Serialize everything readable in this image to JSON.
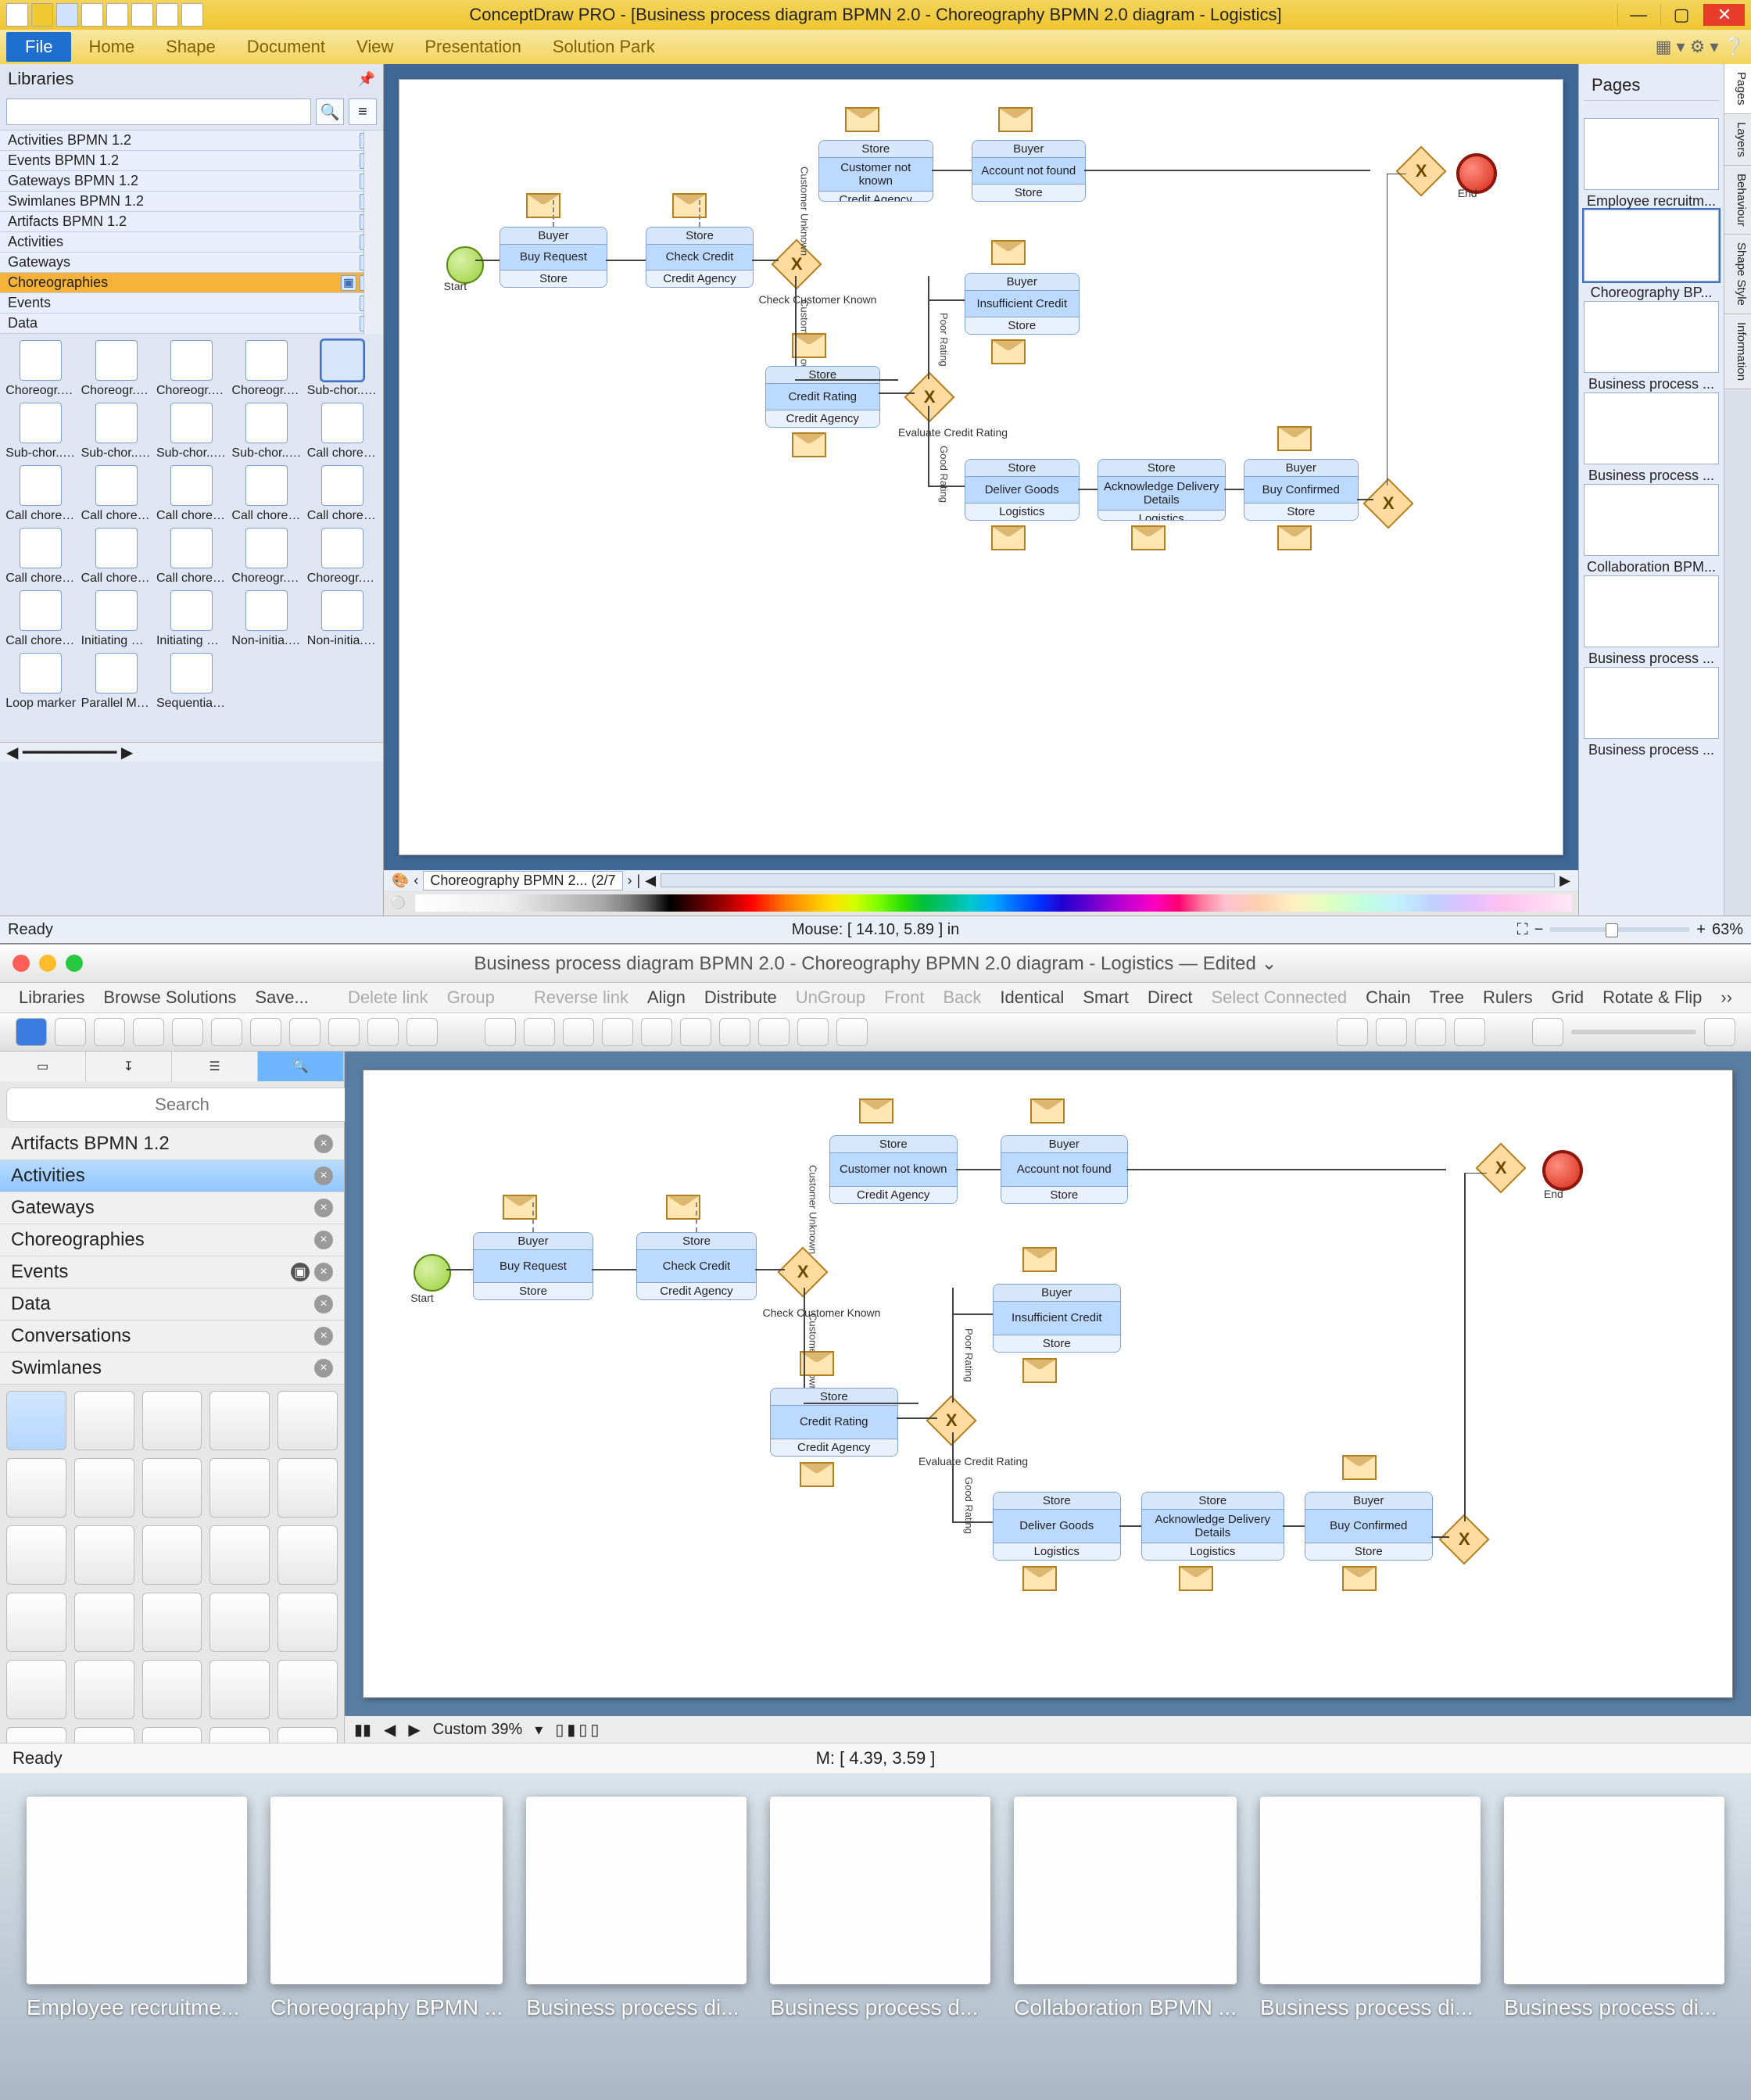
{
  "win": {
    "title": "ConceptDraw PRO - [Business process diagram BPMN 2.0 - Choreography BPMN 2.0 diagram - Logistics]",
    "menu": [
      "Home",
      "Shape",
      "Document",
      "View",
      "Presentation",
      "Solution Park"
    ],
    "file_btn": "File",
    "libraries_label": "Libraries",
    "search_placeholder": "",
    "lib_categories": [
      {
        "name": "Activities BPMN 1.2"
      },
      {
        "name": "Events BPMN 1.2"
      },
      {
        "name": "Gateways BPMN 1.2"
      },
      {
        "name": "Swimlanes BPMN 1.2"
      },
      {
        "name": "Artifacts BPMN 1.2"
      },
      {
        "name": "Activities"
      },
      {
        "name": "Gateways"
      },
      {
        "name": "Choreographies",
        "selected": true
      },
      {
        "name": "Events"
      },
      {
        "name": "Data"
      }
    ],
    "shapes": [
      "Choreogr... task",
      "Choreogr... task - loop",
      "Choreogr... task - sequ...",
      "Choreogr... task - par...",
      "Sub-chor... - collapsed",
      "Sub-chor... - loop - c...",
      "Sub-chor... - sequenti...",
      "Sub-chor... - parallel ...",
      "Sub-chor... - expanded",
      "Call choreogr...",
      "Call choreogr...",
      "Call choreogr...",
      "Call choreogr...",
      "Call choreogr...",
      "Call choreogr...",
      "Call choreogr...",
      "Call choreogr...",
      "Call choreogr...",
      "Choreogr... - MI parti...",
      "Choreogr... - MI parti...",
      "Call choreogr...",
      "Initiating messag...",
      "Initiating message t...",
      "Non-initia... message t...",
      "Non-initia... message ...",
      "Loop marker",
      "Parallel MI marker",
      "Sequential MI marker"
    ],
    "shape_selected_index": 4,
    "pages_label": "Pages",
    "pages": [
      "Employee recruitm...",
      "Choreography BP...",
      "Business process ...",
      "Business process ...",
      "Collaboration BPM...",
      "Business process ...",
      "Business process ..."
    ],
    "pages_selected": 1,
    "sidetabs": [
      "Pages",
      "Layers",
      "Behaviour",
      "Shape Style",
      "Information"
    ],
    "tab_label": "Choreography BPMN 2... (2/7",
    "status_ready": "Ready",
    "mouse": "Mouse: [ 14.10, 5.89 ] in",
    "zoom_pct": "63%"
  },
  "diagram": {
    "start": "Start",
    "end": "End",
    "gateway_main": "Check Customer Known",
    "gateway_rating": "Evaluate Credit Rating",
    "ann_customer_unknown": "Customer Unknown",
    "ann_customer_known": "Customer Known",
    "ann_poor_rating": "Poor Rating",
    "ann_good_rating": "Good Rating",
    "tasks": {
      "buy_request": {
        "head": "Buyer",
        "body": "Buy Request",
        "foot": "Store"
      },
      "check_credit": {
        "head": "Store",
        "body": "Check Credit",
        "foot": "Credit Agency"
      },
      "cust_not_known": {
        "head": "Store",
        "body": "Customer not known",
        "foot": "Credit Agency"
      },
      "acct_not_found": {
        "head": "Buyer",
        "body": "Account not found",
        "foot": "Store"
      },
      "insuff_credit": {
        "head": "Buyer",
        "body": "Insufficient Credit",
        "foot": "Store"
      },
      "credit_rating": {
        "head": "Store",
        "body": "Credit Rating",
        "foot": "Credit Agency"
      },
      "deliver_goods": {
        "head": "Store",
        "body": "Deliver Goods",
        "foot": "Logistics"
      },
      "ack_delivery": {
        "head": "Store",
        "body": "Acknowledge Delivery Details",
        "foot": "Logistics"
      },
      "buy_confirmed": {
        "head": "Buyer",
        "body": "Buy Confirmed",
        "foot": "Store"
      }
    }
  },
  "mac": {
    "title": "Business process diagram BPMN 2.0 - Choreography BPMN 2.0 diagram - Logistics — Edited ⌄",
    "menu_left": [
      "Libraries",
      "Browse Solutions",
      "Save..."
    ],
    "menu_mid_disabled": [
      "Delete link",
      "Group"
    ],
    "menu_right": [
      "Reverse link",
      "Align",
      "Distribute",
      "UnGroup",
      "Front",
      "Back",
      "Identical",
      "Smart",
      "Direct",
      "Select Connected",
      "Chain",
      "Tree",
      "Rulers",
      "Grid",
      "Rotate & Flip"
    ],
    "search_placeholder": "Search",
    "cats": [
      "Artifacts BPMN 1.2",
      "Activities",
      "Gateways",
      "Choreographies",
      "Events",
      "Data",
      "Conversations",
      "Swimlanes"
    ],
    "cat_selected": 1,
    "zoom_label": "Custom 39%",
    "status_ready": "Ready",
    "mouse": "M: [ 4.39, 3.59 ]"
  },
  "thumbs": [
    "Employee recruitme...",
    "Choreography BPMN ...",
    "Business process di...",
    "Business process d...",
    "Collaboration BPMN ...",
    "Business process di...",
    "Business process di..."
  ]
}
